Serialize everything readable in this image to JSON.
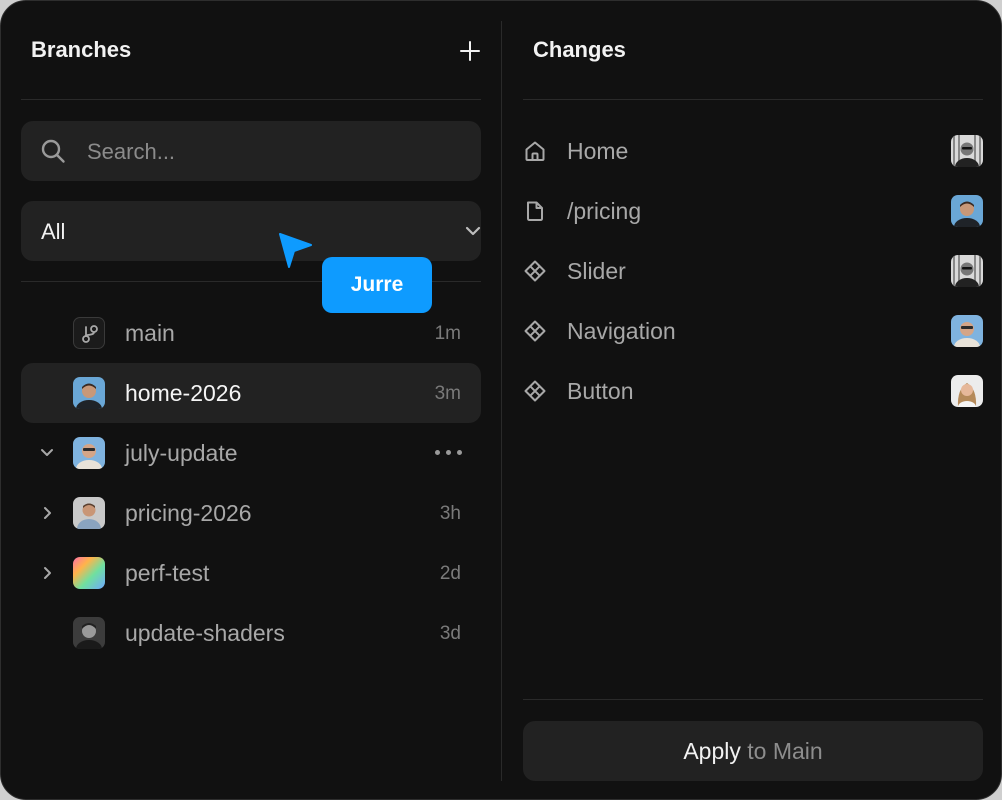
{
  "branches_panel": {
    "title": "Branches",
    "search": {
      "placeholder": "Search...",
      "value": ""
    },
    "filter": {
      "selected": "All"
    },
    "items": [
      {
        "name": "main",
        "time": "1m",
        "avatar": "git-branch-icon"
      },
      {
        "name": "home-2026",
        "time": "3m",
        "avatar": "user-avatar",
        "active": true
      },
      {
        "name": "july-update",
        "time": "",
        "avatar": "user-avatar",
        "expanded": true
      },
      {
        "name": "pricing-2026",
        "time": "3h",
        "avatar": "user-avatar"
      },
      {
        "name": "perf-test",
        "time": "2d",
        "avatar": "gradient-avatar"
      },
      {
        "name": "update-shaders",
        "time": "3d",
        "avatar": "user-avatar"
      }
    ]
  },
  "changes_panel": {
    "title": "Changes",
    "items": [
      {
        "label": "Home",
        "icon": "home-icon"
      },
      {
        "label": "/pricing",
        "icon": "page-icon"
      },
      {
        "label": "Slider",
        "icon": "component-icon"
      },
      {
        "label": "Navigation",
        "icon": "component-icon"
      },
      {
        "label": "Button",
        "icon": "component-icon"
      }
    ],
    "apply": {
      "strong": "Apply",
      "rest": "to Main"
    }
  },
  "cursor": {
    "name": "Jurre",
    "color": "#0e9bff"
  },
  "colors": {
    "background": "#111111",
    "surface": "#222222",
    "accent": "#0e9bff"
  }
}
